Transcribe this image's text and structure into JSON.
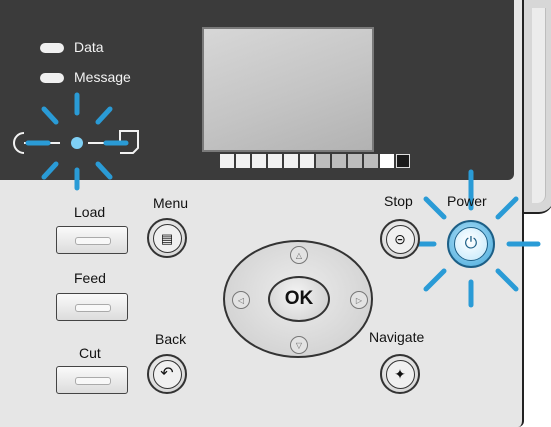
{
  "indicators": {
    "data_label": "Data",
    "message_label": "Message"
  },
  "display": {
    "segments": [
      "#f2f2f2",
      "#f2f2f2",
      "#f2f2f2",
      "#f2f2f2",
      "#f2f2f2",
      "#f2f2f2",
      "#bdbdbd",
      "#bdbdbd",
      "#bdbdbd",
      "#bdbdbd",
      "#ffffff",
      "#bdbdbd"
    ]
  },
  "buttons": {
    "load": "Load",
    "feed": "Feed",
    "cut": "Cut",
    "menu": "Menu",
    "back": "Back",
    "ok": "OK",
    "stop": "Stop",
    "power": "Power",
    "navigate": "Navigate"
  },
  "colors": {
    "highlight": "#2a9bd6",
    "power_fill": "#43a8da",
    "panel_dark": "#3b3b3b"
  },
  "icons": [
    "paper-load-icon",
    "menu-list-icon",
    "back-arrow-icon",
    "stop-icon",
    "power-icon",
    "navigate-icon",
    "up-arrow-icon",
    "down-arrow-icon",
    "left-arrow-icon",
    "right-arrow-icon"
  ]
}
